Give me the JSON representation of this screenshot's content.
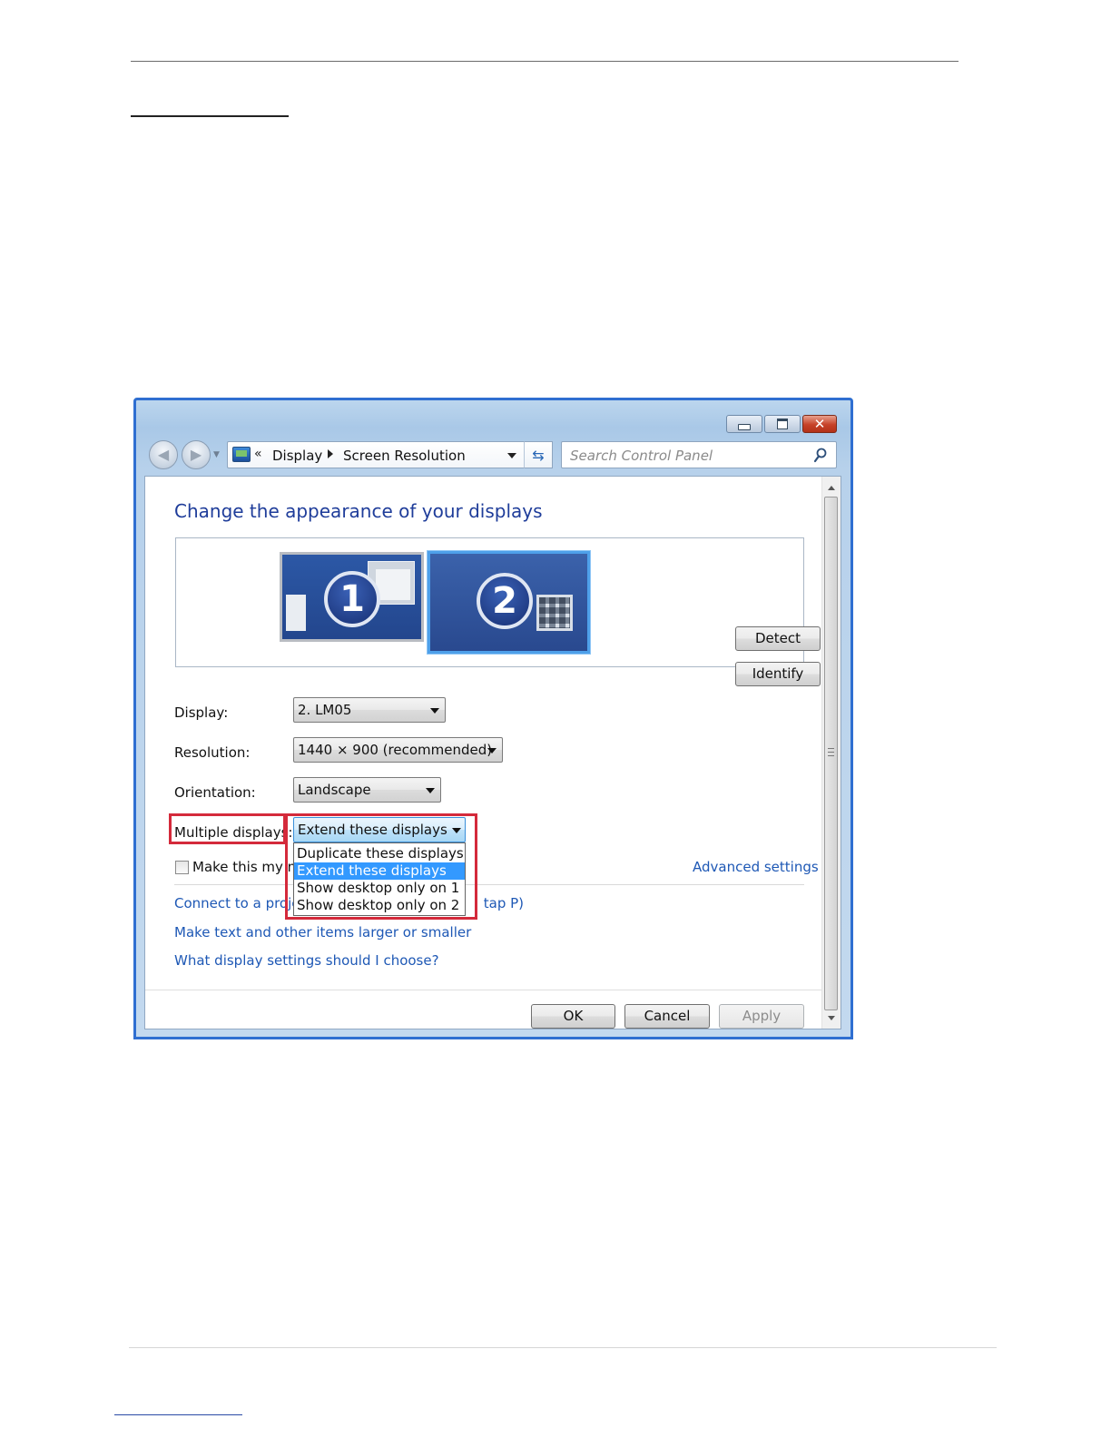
{
  "window": {
    "address": {
      "chevrons": "«",
      "crumbs": [
        "Display",
        "Screen Resolution"
      ]
    },
    "search": {
      "placeholder": "Search Control Panel"
    },
    "caption_buttons": {
      "close": "✕"
    }
  },
  "content": {
    "title": "Change the appearance of your displays",
    "monitors": [
      {
        "number": "1",
        "selected": false
      },
      {
        "number": "2",
        "selected": true
      }
    ],
    "buttons": {
      "detect": "Detect",
      "identify": "Identify"
    },
    "fields": {
      "display": {
        "label": "Display:",
        "value": "2. LM05"
      },
      "resolution": {
        "label": "Resolution:",
        "value": "1440 × 900 (recommended)"
      },
      "orientation": {
        "label": "Orientation:",
        "value": "Landscape"
      },
      "multiple_displays": {
        "label": "Multiple displays:",
        "value": "Extend these displays",
        "options": [
          "Duplicate these displays",
          "Extend these displays",
          "Show desktop only on 1",
          "Show desktop only on 2"
        ],
        "highlighted_index": 1
      }
    },
    "checkbox": {
      "label_visible": "Make this my ma",
      "checked": false
    },
    "advanced_link": "Advanced settings",
    "links": {
      "projector_visible_prefix": "Connect to a projec",
      "projector_visible_suffix": "tap P)",
      "text_size": "Make text and other items larger or smaller",
      "help": "What display settings should I choose?"
    },
    "dialog_buttons": {
      "ok": "OK",
      "cancel": "Cancel",
      "apply": "Apply"
    }
  },
  "colors": {
    "highlight_box": "#d42a3b",
    "link": "#1e58b5",
    "title": "#1f3d9a",
    "selection": "#3399ff",
    "window_border": "#2f6fd1"
  }
}
